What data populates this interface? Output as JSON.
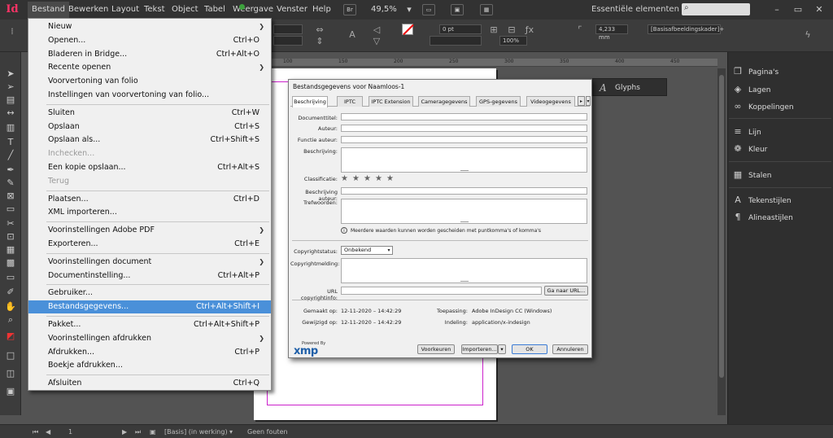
{
  "app": {
    "logo": "Id"
  },
  "menubar": {
    "items": [
      "Bestand",
      "Bewerken",
      "Layout",
      "Tekst",
      "Object",
      "Tabel",
      "Weergave",
      "Venster",
      "Help"
    ],
    "bridge_label": "Br",
    "zoom": "49,5%",
    "workspace": "Essentiële elementen",
    "workspace_arrow": "▾"
  },
  "control_panel": {
    "stroke_weight": "0 pt",
    "dimension": "4,233 mm",
    "opacity": "100%",
    "object_style": "[Basisafbeeldingskader]+"
  },
  "file_menu": {
    "groups": [
      [
        {
          "label": "Nieuw",
          "shortcut": "",
          "submenu": true
        },
        {
          "label": "Openen...",
          "shortcut": "Ctrl+O"
        },
        {
          "label": "Bladeren in Bridge...",
          "shortcut": "Ctrl+Alt+O"
        },
        {
          "label": "Recente openen",
          "shortcut": "",
          "submenu": true
        },
        {
          "label": "Voorvertoning van folio",
          "shortcut": ""
        },
        {
          "label": "Instellingen van voorvertoning van folio...",
          "shortcut": ""
        }
      ],
      [
        {
          "label": "Sluiten",
          "shortcut": "Ctrl+W"
        },
        {
          "label": "Opslaan",
          "shortcut": "Ctrl+S"
        },
        {
          "label": "Opslaan als...",
          "shortcut": "Ctrl+Shift+S"
        },
        {
          "label": "Inchecken...",
          "shortcut": "",
          "disabled": true
        },
        {
          "label": "Een kopie opslaan...",
          "shortcut": "Ctrl+Alt+S"
        },
        {
          "label": "Terug",
          "shortcut": "",
          "disabled": true
        }
      ],
      [
        {
          "label": "Plaatsen...",
          "shortcut": "Ctrl+D"
        },
        {
          "label": "XML importeren...",
          "shortcut": ""
        }
      ],
      [
        {
          "label": "Voorinstellingen Adobe PDF",
          "shortcut": "",
          "submenu": true
        },
        {
          "label": "Exporteren...",
          "shortcut": "Ctrl+E"
        }
      ],
      [
        {
          "label": "Voorinstellingen document",
          "shortcut": "",
          "submenu": true
        },
        {
          "label": "Documentinstelling...",
          "shortcut": "Ctrl+Alt+P"
        }
      ],
      [
        {
          "label": "Gebruiker...",
          "shortcut": ""
        },
        {
          "label": "Bestandsgegevens...",
          "shortcut": "Ctrl+Alt+Shift+I",
          "highlight": true
        }
      ],
      [
        {
          "label": "Pakket...",
          "shortcut": "Ctrl+Alt+Shift+P"
        },
        {
          "label": "Voorinstellingen afdrukken",
          "shortcut": "",
          "submenu": true
        },
        {
          "label": "Afdrukken...",
          "shortcut": "Ctrl+P"
        },
        {
          "label": "Boekje afdrukken...",
          "shortcut": ""
        }
      ],
      [
        {
          "label": "Afsluiten",
          "shortcut": "Ctrl+Q"
        }
      ]
    ]
  },
  "dialog": {
    "title": "Bestandsgegevens voor Naamloos-1",
    "tabs": [
      "Beschrijving",
      "IPTC",
      "IPTC Extension",
      "Cameragegevens",
      "GPS-gegevens",
      "Videogegevens"
    ],
    "tab_arrow": "▸",
    "labels": {
      "document_title": "Documenttitel:",
      "author": "Auteur:",
      "author_title": "Functie auteur:",
      "description": "Beschrijving:",
      "rating": "Classificatie:",
      "description_writer": "Beschrijving auteur:",
      "keywords": "Trefwoorden:",
      "copyright_status": "Copyrightstatus:",
      "copyright_notice": "Copyrightmelding:",
      "copyright_url": "URL copyrightinfo:"
    },
    "keywords_hint": "Meerdere waarden kunnen worden gescheiden met puntkomma's of komma's",
    "copyright_status_value": "Onbekend",
    "goto_url_button": "Ga naar URL...",
    "meta": {
      "created_label": "Gemaakt op:",
      "created_value": "12-11-2020 – 14:42:29",
      "modified_label": "Gewijzigd op:",
      "modified_value": "12-11-2020 – 14:42:29",
      "application_label": "Toepassing:",
      "application_value": "Adobe InDesign CC (Windows)",
      "format_label": "Indeling:",
      "format_value": "application/x-indesign"
    },
    "powered_by": "Powered By",
    "xmp_logo": "xmp",
    "buttons": {
      "preferences": "Voorkeuren",
      "import": "Importeren...",
      "ok": "OK",
      "cancel": "Annuleren"
    }
  },
  "ruler": {
    "numbers": [
      "100",
      "150",
      "200",
      "250",
      "300",
      "350",
      "400",
      "450"
    ]
  },
  "panels": {
    "glyphs": "Glyphs",
    "items": [
      "Pagina's",
      "Lagen",
      "Koppelingen",
      "Lijn",
      "Kleur",
      "Stalen",
      "Tekenstijlen",
      "Alineastijlen"
    ]
  },
  "statusbar": {
    "page": "1",
    "master": "[Basis] (in werking)",
    "errors": "Geen fouten"
  }
}
